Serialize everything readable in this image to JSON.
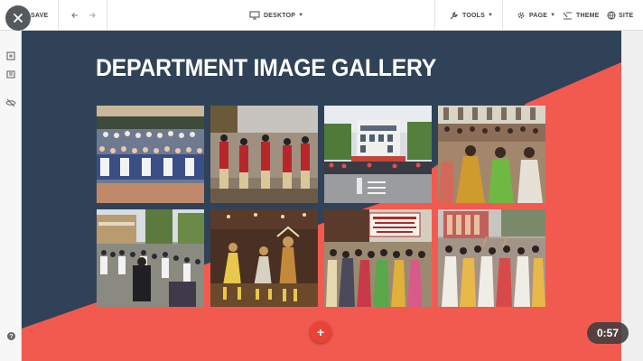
{
  "toolbar": {
    "save_label": "SAVE",
    "device_label": "DESKTOP",
    "tools_label": "TOOLS",
    "page_label": "PAGE",
    "theme_label": "THEME",
    "site_label": "SITE"
  },
  "canvas": {
    "title": "DEPARTMENT IMAGE GALLERY",
    "background_color": "#2f4257",
    "accent_color": "#f25a50"
  },
  "gallery": {
    "photos": [
      {
        "subject": "group-photo-students"
      },
      {
        "subject": "stage-dance-performance"
      },
      {
        "subject": "college-building"
      },
      {
        "subject": "audience-seated"
      },
      {
        "subject": "campus-gathering"
      },
      {
        "subject": "cultural-dance-stage"
      },
      {
        "subject": "banner-group-photo"
      },
      {
        "subject": "group-celebration"
      }
    ]
  },
  "left_rail": {
    "icons": [
      "pages-icon",
      "layers-icon",
      "hide-icon",
      "help-icon"
    ]
  },
  "video": {
    "timer": "0:57"
  }
}
